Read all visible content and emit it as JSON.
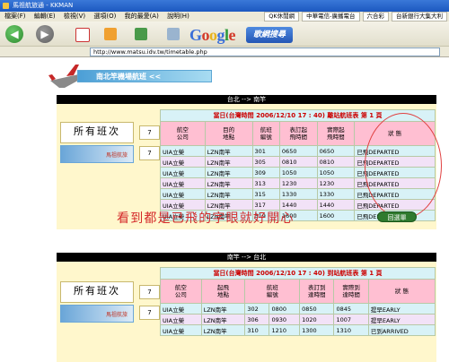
{
  "window": {
    "title": "馬祖航旅通 - KKMAN"
  },
  "menu": [
    "檔案(F)",
    "編輯(E)",
    "檢視(V)",
    "選項(O)",
    "我的最愛(A)",
    "說明(H)"
  ],
  "tabs": [
    "QK休閒網",
    "中華電信-廣播電台",
    "六合彩",
    "台新銀行大集大利"
  ],
  "toolbar": {
    "google_letters": [
      "G",
      "o",
      "o",
      "g",
      "l",
      "e"
    ],
    "search_label": "歌網搜尋"
  },
  "address": {
    "url": "http://www.matsu.idv.tw/timetable.php"
  },
  "banner": {
    "text": "南北竿機場航班 <<"
  },
  "section1": {
    "heading": "台北 --> 南竿",
    "all_flights": "所有班次",
    "counts": [
      "7",
      "7"
    ],
    "thumb_label": "馬祖航旅",
    "caption": "當日(台灣時間 2006/12/10 17 : 40) 離站航班表 第 1 頁",
    "columns": [
      "航空\n公司",
      "目的\n地點",
      "航班\n編號",
      "表訂起\n飛時間",
      "實際起\n飛時間",
      "狀 態"
    ],
    "rows": [
      [
        "UIA立榮",
        "LZN南竿",
        "301",
        "0650",
        "0650",
        "已飛DEPARTED"
      ],
      [
        "UIA立榮",
        "LZN南竿",
        "305",
        "0810",
        "0810",
        "已飛DEPARTED"
      ],
      [
        "UIA立榮",
        "LZN南竿",
        "309",
        "1050",
        "1050",
        "已飛DEPARTED"
      ],
      [
        "UIA立榮",
        "LZN南竿",
        "313",
        "1230",
        "1230",
        "已飛DEPARTED"
      ],
      [
        "UIA立榮",
        "LZN南竿",
        "315",
        "1330",
        "1330",
        "已飛DEPARTED"
      ],
      [
        "UIA立榮",
        "LZN南竿",
        "317",
        "1440",
        "1440",
        "已飛DEPARTED"
      ],
      [
        "UIA立榮",
        "LZN南竿",
        "319",
        "1600",
        "1600",
        "已飛DEPARTED"
      ]
    ]
  },
  "annotation": "看到都是已飛的字眼就好開心",
  "back_button": "回選單",
  "section2": {
    "heading": "南竿 --> 台北",
    "all_flights": "所有班次",
    "counts": [
      "7",
      "7"
    ],
    "thumb_label": "馬祖航旅",
    "caption": "當日(台灣時間 2006/12/10 17 : 40) 到站航班表 第 1 頁",
    "columns": [
      "航空\n公司",
      "起飛\n地點",
      "航班\n編號",
      "表訂到\n達時間",
      "實際到\n達時間",
      "狀 態"
    ],
    "rows": [
      [
        "UIA立榮",
        "LZN南竿",
        "302",
        "0800",
        "0850",
        "0845",
        "提早EARLY"
      ],
      [
        "UIA立榮",
        "LZN南竿",
        "306",
        "0930",
        "1020",
        "1007",
        "提早EARLY"
      ],
      [
        "UIA立榮",
        "LZN南竿",
        "310",
        "1210",
        "1300",
        "1310",
        "已到ARRIVED"
      ]
    ]
  },
  "colors": {
    "accent_red": "#cc0000",
    "annotation": "#d42a2a",
    "header_pink": "#ffbfd2",
    "caption_blue": "#9fd9ef"
  }
}
